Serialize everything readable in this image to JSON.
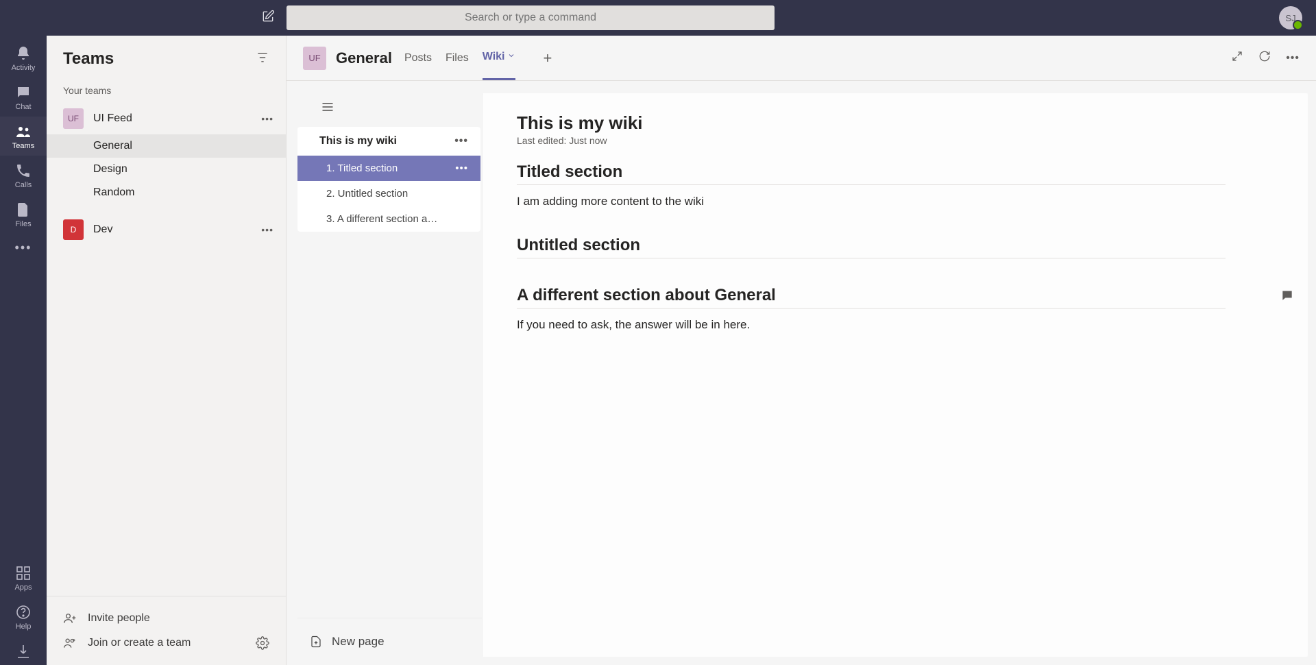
{
  "search": {
    "placeholder": "Search or type a command"
  },
  "avatar": {
    "initials": "SJ"
  },
  "rail": {
    "activity": "Activity",
    "chat": "Chat",
    "teams": "Teams",
    "calls": "Calls",
    "files": "Files",
    "apps": "Apps",
    "help": "Help"
  },
  "teamsPanel": {
    "title": "Teams",
    "yourTeams": "Your teams",
    "teams": [
      {
        "initials": "UF",
        "name": "UI Feed",
        "avatarClass": "uf",
        "channels": [
          "General",
          "Design",
          "Random"
        ],
        "activeChannel": "General"
      },
      {
        "initials": "D",
        "name": "Dev",
        "avatarClass": "d",
        "channels": []
      }
    ],
    "invite": "Invite people",
    "joinCreate": "Join or create a team"
  },
  "contentHeader": {
    "teamInitials": "UF",
    "channelName": "General",
    "tabs": {
      "posts": "Posts",
      "files": "Files",
      "wiki": "Wiki"
    }
  },
  "wiki": {
    "pageTitle": "This is my wiki",
    "lastEdited": "Last edited: Just now",
    "navSections": [
      "1. Titled section",
      "2. Untitled section",
      "3. A different section a…"
    ],
    "sections": [
      {
        "heading": "Titled section",
        "body": "I am adding more content to the wiki"
      },
      {
        "heading": "Untitled section",
        "body": ""
      },
      {
        "heading": "A different section about General",
        "body": "If you need to ask, the answer will be in here."
      }
    ],
    "newPage": "New page"
  }
}
